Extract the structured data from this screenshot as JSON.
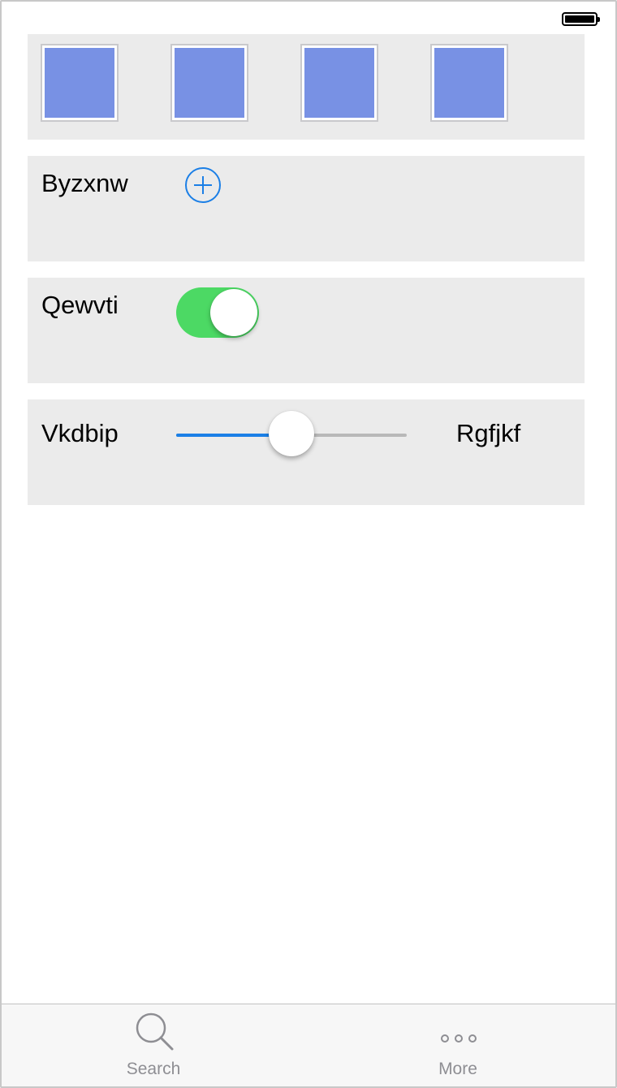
{
  "status_bar": {
    "battery_icon": "battery-full-icon"
  },
  "thumbnails": {
    "count": 4,
    "fill_color": "#7891e4"
  },
  "row_add": {
    "label": "Byzxnw",
    "icon": "plus-circle-icon",
    "accent": "#1b7fe6"
  },
  "row_toggle": {
    "label": "Qewvti",
    "on": true,
    "on_color": "#4cd964"
  },
  "row_slider": {
    "label_left": "Vkdbip",
    "label_right": "Rgfjkf",
    "value": 0.5,
    "accent": "#1b7fe6"
  },
  "tabbar": {
    "tabs": [
      {
        "label": "Search",
        "icon": "search-icon"
      },
      {
        "label": "More",
        "icon": "more-icon"
      }
    ]
  }
}
